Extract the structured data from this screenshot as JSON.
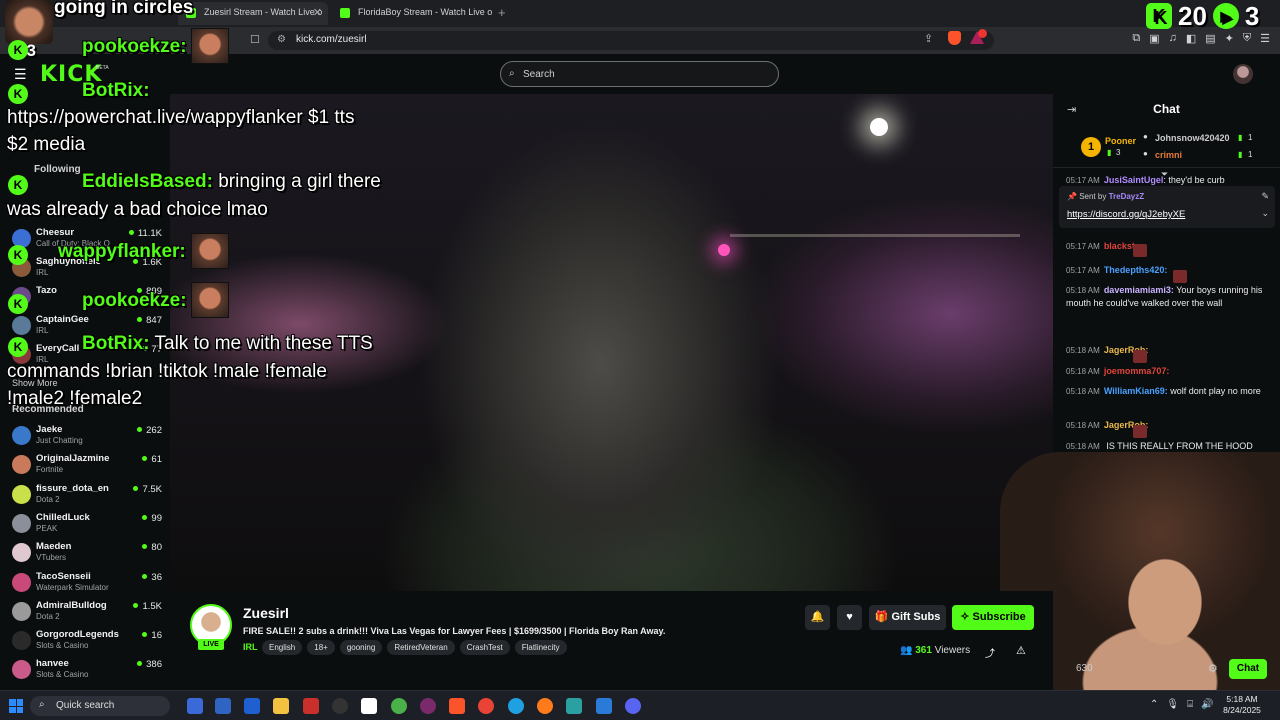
{
  "browser": {
    "tabs": [
      {
        "label": "Zuesirl Stream - Watch Live o"
      },
      {
        "label": "FloridaBoy Stream - Watch Live on K"
      }
    ],
    "url": "kick.com/zuesirl"
  },
  "header": {
    "logo": "KICK",
    "beta": "BETA",
    "search_placeholder": "Search"
  },
  "sidebar": {
    "following_label": "Following",
    "following": [
      {
        "name": "Cheesur",
        "category": "Call of Duty: Black O",
        "viewers": "11.1K",
        "color": "#3b6fd4"
      },
      {
        "name": "Saghuyhofiele",
        "category": "IRL",
        "viewers": "1.6K",
        "color": "#8a5a3a"
      },
      {
        "name": "Tazo",
        "category": "",
        "viewers": "899",
        "color": "#6a4a8a"
      },
      {
        "name": "CaptainGee",
        "category": "IRL",
        "viewers": "847",
        "color": "#5a7a9a"
      },
      {
        "name": "EveryCall",
        "category": "IRL",
        "viewers": "77",
        "color": "#8a3a3a"
      }
    ],
    "show_more": "Show More",
    "recommended_label": "Recommended",
    "recommended": [
      {
        "name": "Jaeke",
        "category": "Just Chatting",
        "viewers": "262",
        "color": "#3a78c9"
      },
      {
        "name": "OriginalJazmine",
        "category": "Fortnite",
        "viewers": "61",
        "color": "#c97a5a"
      },
      {
        "name": "fissure_dota_en",
        "category": "Dota 2",
        "viewers": "7.5K",
        "color": "#c9e04a"
      },
      {
        "name": "ChilledLuck",
        "category": "PEAK",
        "viewers": "99",
        "color": "#8a8f99"
      },
      {
        "name": "Maeden",
        "category": "VTubers",
        "viewers": "80",
        "color": "#e0c8d0"
      },
      {
        "name": "TacoSenseii",
        "category": "Waterpark Simulator",
        "viewers": "36",
        "color": "#c94a7a"
      },
      {
        "name": "AdmiralBulldog",
        "category": "Dota 2",
        "viewers": "1.5K",
        "color": "#9a9a9a"
      },
      {
        "name": "GorgorodLegends",
        "category": "Slots & Casino",
        "viewers": "16",
        "color": "#2a2a2a"
      },
      {
        "name": "hanvee",
        "category": "Slots & Casino",
        "viewers": "386",
        "color": "#c95a8a"
      }
    ]
  },
  "overlay": {
    "top_text": "going in circles",
    "x3": "x3",
    "counter_left": "20",
    "counter_right": "3",
    "messages": [
      {
        "user": "pookoekze:",
        "text": ""
      },
      {
        "user": "BotRix:",
        "text": ""
      },
      {
        "user": "",
        "text": "https://powerchat.live/wappyflanker $1 tts"
      },
      {
        "user": "",
        "text": "$2 media"
      },
      {
        "user": "EddieIsBased:",
        "text": "bringing a girl there"
      },
      {
        "user": "",
        "text": "was already a bad choice lmao"
      },
      {
        "user": "wappyflanker:",
        "text": ""
      },
      {
        "user": "pookoekze:",
        "text": ""
      },
      {
        "user": "BotRix:",
        "text": "Talk to me with these TTS"
      },
      {
        "user": "",
        "text": "commands !brian !tiktok !male !female"
      },
      {
        "user": "",
        "text": "!male2 !female2"
      }
    ]
  },
  "chat": {
    "title": "Chat",
    "leaderboard": {
      "first": {
        "rank": "1",
        "name": "Pooner",
        "subs": "3"
      },
      "second": {
        "name": "Johnsnow420420",
        "count": "1"
      },
      "third": {
        "name": "crimni",
        "count": "1"
      }
    },
    "pinned": {
      "sent_by": "Sent by",
      "sender": "TreDayzZ",
      "link": "https://discord.gg/qJ2ebyXE"
    },
    "peek_message": {
      "time": "05:17 AM",
      "user": "JusiSaintUgel",
      "text": "they'd be curb"
    },
    "messages": [
      {
        "time": "05:17 AM",
        "user": "blackstar:",
        "user_color": "#e0443a",
        "text": ""
      },
      {
        "time": "05:17 AM",
        "user": "Thedepths420:",
        "user_color": "#4aa0ff",
        "text": ""
      },
      {
        "time": "05:18 AM",
        "user": "davemiamiami3:",
        "user_color": "#c8b2ff",
        "text": "Your boys running his mouth he could've walked over the wall"
      },
      {
        "time": "05:18 AM",
        "user": "JagerRob:",
        "user_color": "#e8b84a",
        "text": ""
      },
      {
        "time": "05:18 AM",
        "user": "joemomma707:",
        "user_color": "#e0443a",
        "text": ""
      },
      {
        "time": "05:18 AM",
        "user": "WilliamKian69:",
        "user_color": "#4aa0ff",
        "text": "wolf dont play no more"
      },
      {
        "time": "05:18 AM",
        "user": "JagerRob:",
        "user_color": "#e8b84a",
        "text": ""
      },
      {
        "time": "05:18 AM",
        "user": "",
        "user_color": "#888888",
        "text": "IS THIS REALLY FROM THE HOOD"
      }
    ],
    "cam_count": "630",
    "chat_button": "Chat"
  },
  "stream": {
    "streamer": "Zuesirl",
    "live": "LIVE",
    "title": "FIRE SALE!! 2 subs a drink!!! Viva Las Vegas for Lawyer Fees | $1699/3500 | Florida Boy Ran Away.",
    "category": "IRL",
    "tags": [
      "English",
      "18+",
      "gooning",
      "RetiredVeteran",
      "CrashTest",
      "Flatlinecity"
    ],
    "gift_label": "Gift Subs",
    "subscribe_label": "Subscribe",
    "viewers": "361",
    "viewers_label": "Viewers"
  },
  "taskbar": {
    "search": "Quick search",
    "time": "5:18 AM",
    "date": "8/24/2025"
  },
  "colors": {
    "kick_green": "#53fc18",
    "background": "#0b0e0f"
  }
}
